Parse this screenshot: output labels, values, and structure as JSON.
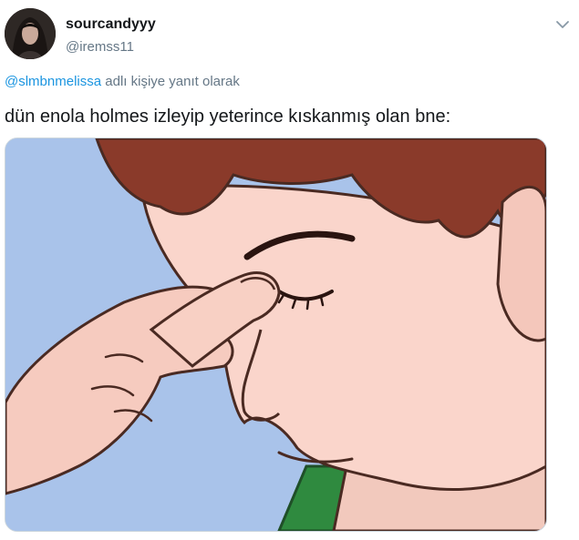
{
  "tweet": {
    "author": {
      "display_name": "sourcandyyy",
      "handle": "@iremss11",
      "avatar": "avatar-photo"
    },
    "menu_icon": "chevron-down-icon",
    "reply_context": {
      "mention": "@slmbnmelissa",
      "suffix": " adlı kişiye yanıt olarak"
    },
    "text": "dün enola holmes izleyip yeterince kıskanmış olan bne:",
    "media": {
      "kind": "illustration",
      "subject": "facepalm-illustration"
    },
    "colors": {
      "text": "#14171a",
      "secondary": "#657786",
      "link": "#1b95e0"
    }
  }
}
